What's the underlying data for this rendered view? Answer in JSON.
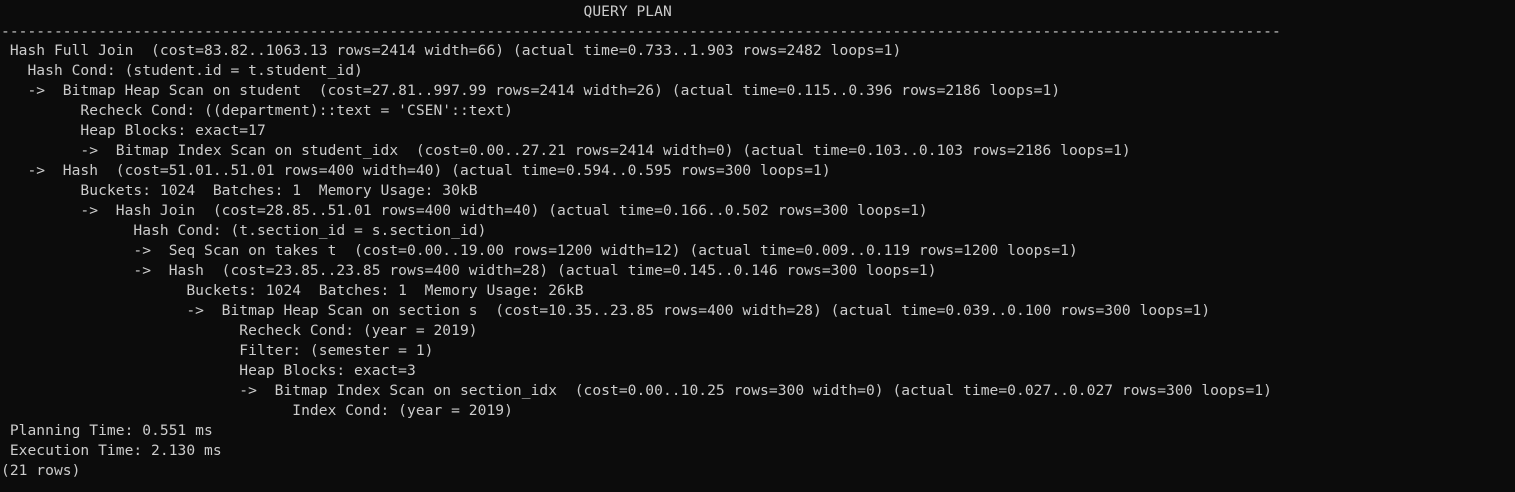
{
  "terminal": {
    "lines": [
      "                                                                  QUERY PLAN",
      "-------------------------------------------------------------------------------------------------------------------------------------------------",
      " Hash Full Join  (cost=83.82..1063.13 rows=2414 width=66) (actual time=0.733..1.903 rows=2482 loops=1)",
      "   Hash Cond: (student.id = t.student_id)",
      "   ->  Bitmap Heap Scan on student  (cost=27.81..997.99 rows=2414 width=26) (actual time=0.115..0.396 rows=2186 loops=1)",
      "         Recheck Cond: ((department)::text = 'CSEN'::text)",
      "         Heap Blocks: exact=17",
      "         ->  Bitmap Index Scan on student_idx  (cost=0.00..27.21 rows=2414 width=0) (actual time=0.103..0.103 rows=2186 loops=1)",
      "   ->  Hash  (cost=51.01..51.01 rows=400 width=40) (actual time=0.594..0.595 rows=300 loops=1)",
      "         Buckets: 1024  Batches: 1  Memory Usage: 30kB",
      "         ->  Hash Join  (cost=28.85..51.01 rows=400 width=40) (actual time=0.166..0.502 rows=300 loops=1)",
      "               Hash Cond: (t.section_id = s.section_id)",
      "               ->  Seq Scan on takes t  (cost=0.00..19.00 rows=1200 width=12) (actual time=0.009..0.119 rows=1200 loops=1)",
      "               ->  Hash  (cost=23.85..23.85 rows=400 width=28) (actual time=0.145..0.146 rows=300 loops=1)",
      "                     Buckets: 1024  Batches: 1  Memory Usage: 26kB",
      "                     ->  Bitmap Heap Scan on section s  (cost=10.35..23.85 rows=400 width=28) (actual time=0.039..0.100 rows=300 loops=1)",
      "                           Recheck Cond: (year = 2019)",
      "                           Filter: (semester = 1)",
      "                           Heap Blocks: exact=3",
      "                           ->  Bitmap Index Scan on section_idx  (cost=0.00..10.25 rows=300 width=0) (actual time=0.027..0.027 rows=300 loops=1)",
      "                                 Index Cond: (year = 2019)",
      " Planning Time: 0.551 ms",
      " Execution Time: 2.130 ms",
      "(21 rows)"
    ]
  }
}
